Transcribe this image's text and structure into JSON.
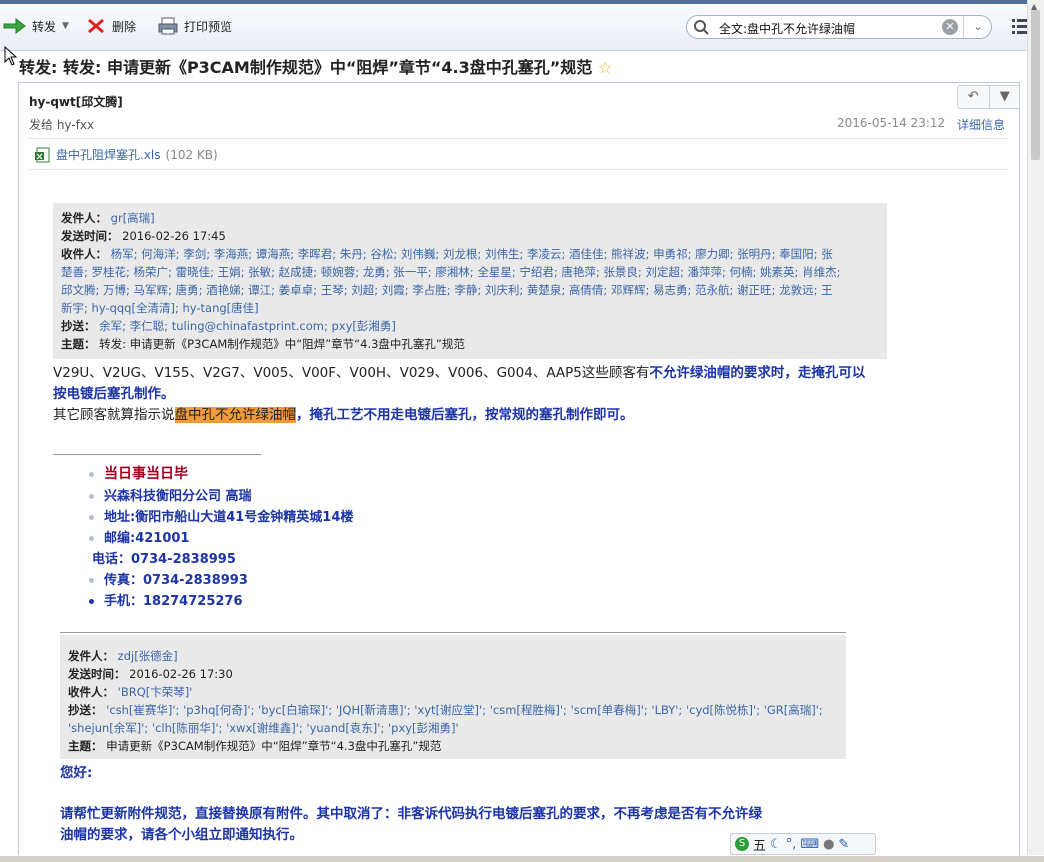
{
  "toolbar": {
    "forward_label": "转发",
    "delete_label": "删除",
    "print_label": "打印预览"
  },
  "search": {
    "query": "全文:盘中孔不允许绿油帽"
  },
  "email": {
    "subject": "转发: 转发: 申请更新《P3CAM制作规范》中“阻焊”章节“4.3盘中孔塞孔”规范",
    "sender": "hy-qwt[邱文腾]",
    "recipient_line": "发给 hy-fxx",
    "datetime": "2016-05-14 23:12",
    "details_link": "详细信息",
    "attachment_name": "盘中孔阻焊塞孔.xls",
    "attachment_size": "(102 KB)"
  },
  "quote1": {
    "from_label": "发件人：",
    "from": "gr[高瑞]",
    "sent_label": "发送时间：",
    "sent": "2016-02-26 17:45",
    "to_label": "收件人：",
    "to_line1": "杨军; 何海洋; 李剑; 李海燕; 谭海燕; 李晖君; 朱丹; 谷松; 刘伟巍; 刘龙根; 刘伟生; 李凌云; 酒佳佳; 熊祥波; 申勇祁; 廖力卿; 张明丹; 奉国阳; 张",
    "to_line2": "楚善; 罗桂花; 杨荣广; 雷晓佳; 王娟; 张敏; 赵成捷; 顿婉蓉; 龙勇; 张一平; 廖湘林; 全星星; 宁绍君; 唐艳萍; 张景良; 刘定超; 潘萍萍; 何楠; 姚素英; 肖维杰;",
    "to_line3": "邱文腾; 万博; 马军辉; 唐勇; 酒艳娣; 谭江; 姜卓卓; 王琴; 刘超; 刘霞; 李占胜; 李静; 刘庆利; 黄楚泉; 高倩倩; 邓辉辉; 易志勇; 范永航; 谢正旺; 龙敦远; 王",
    "to_line4": "新宇; ",
    "to_line4_links": "hy-qqq[全清清]; hy-tang[唐佳]",
    "cc_label": "抄送：",
    "cc_names": "余军; 李仁聪; ",
    "cc_links": "tuling@chinafastprint.com; pxy[彭湘勇]",
    "subject_label": "主题：",
    "subject": "转发: 申请更新《P3CAM制作规范》中“阻焊”章节“4.3盘中孔塞孔”规范"
  },
  "body": {
    "line1_plain": "V29U、V2UG、V155、V2G7、V005、V00F、V00H、V029、V006、G004、AAP5这些顾客有",
    "line1_bold": "不允许绿油帽的要求时，走掩孔可以",
    "line2_bold": "按电镀后塞孔制作。",
    "line3_plain": "其它顾客就算指示说",
    "line3_highlight": "盘中孔不允许绿油帽",
    "line3_bold": "，掩孔工艺不用走电镀后塞孔，按常规的塞孔制作即可。"
  },
  "signature": {
    "motto": "当日事当日毕",
    "company": "兴森科技衡阳分公司    高瑞",
    "address": "地址:衡阳市船山大道41号金钟精英城14楼",
    "postcode": "邮编:421001",
    "phone": "电话：0734-2838995",
    "fax": "传真：0734-2838993",
    "mobile": "手机：18274725276"
  },
  "quote2": {
    "from_label": "发件人：",
    "from": "zdj[张德金]",
    "sent_label": "发送时间：",
    "sent": "2016-02-26 17:30",
    "to_label": "收件人：",
    "to": "'BRQ[卞荣琴]'",
    "cc_label": "抄送：",
    "cc_line1": "'csh[崔赛华]'; 'p3hq[何奇]'; 'byc[白瑜琛]'; 'JQH[靳清惠]'; 'xyt[谢应堂]'; 'csm[程胜梅]'; 'scm[单春梅]'; 'LBY'; 'cyd[陈悦栋]'; 'GR[高瑞]';",
    "cc_line2": "'shejun[余军]'; 'clh[陈丽华]'; 'xwx[谢维鑫]'; 'yuand[袁东]'; 'pxy[彭湘勇]'",
    "subject_label": "主题：",
    "subject": "申请更新《P3CAM制作规范》中“阻焊”章节“4.3盘中孔塞孔”规范"
  },
  "body2": {
    "greeting": "您好:",
    "para_line1": "请帮忙更新附件规范，直接替换原有附件。其中取消了：非客诉代码执行电镀后塞孔的要求，不再考虑是否有不允许绿",
    "para_line2": "油帽的要求，请各个小组立即通知执行。"
  },
  "ime": {
    "mode": "五"
  }
}
